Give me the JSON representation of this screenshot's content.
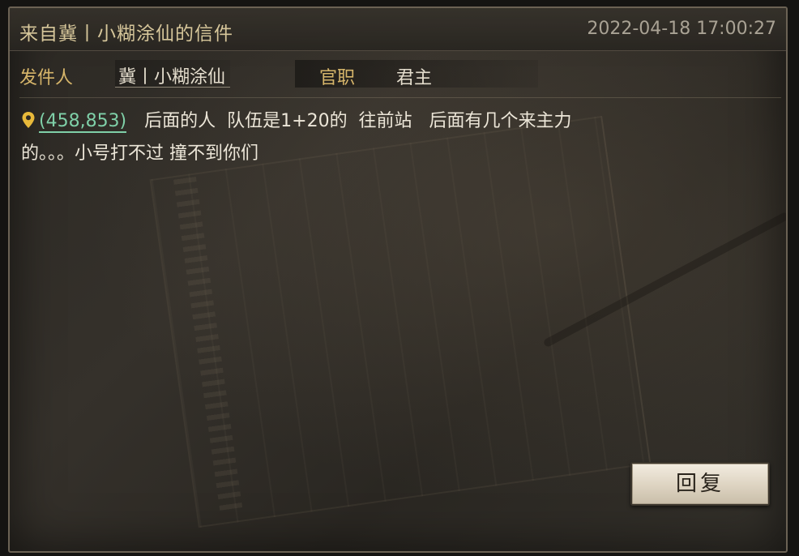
{
  "window": {
    "title": "来自冀丨小糊涂仙的信件",
    "timestamp": "2022-04-18 17:00:27"
  },
  "sender": {
    "label": "发件人",
    "value": "冀丨小糊涂仙"
  },
  "rank": {
    "label": "官职",
    "value": "君主"
  },
  "message": {
    "coordinates": "(458,853)",
    "line1_text": "后面的人  队伍是1+20的  往前站   后面有几个来主力",
    "line2_text": "的。。。小号打不过 撞不到你们"
  },
  "actions": {
    "reply_label": "回复"
  },
  "colors": {
    "title_gold": "#d6c69a",
    "label_gold": "#d6b56a",
    "coord_green": "#7fd0a8",
    "text_light": "#ece6d8"
  }
}
